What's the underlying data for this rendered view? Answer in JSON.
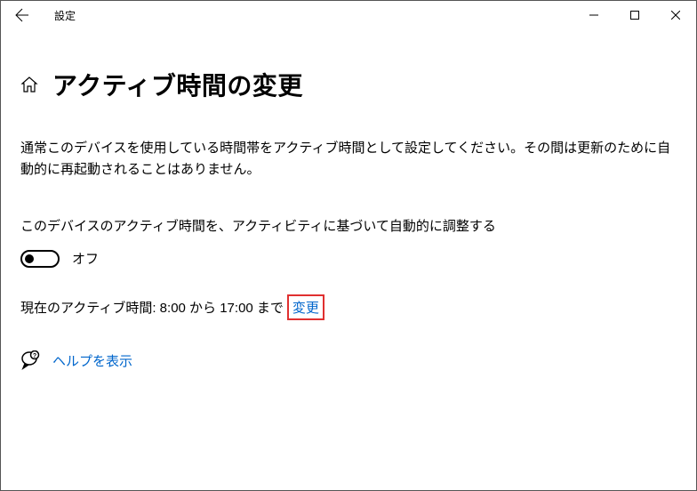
{
  "titlebar": {
    "title": "設定"
  },
  "page": {
    "heading": "アクティブ時間の変更",
    "description": "通常このデバイスを使用している時間帯をアクティブ時間として設定してください。その間は更新のために自動的に再起動されることはありません。",
    "auto_adjust_label": "このデバイスのアクティブ時間を、アクティビティに基づいて自動的に調整する",
    "toggle_state": "オフ",
    "current_hours_prefix": "現在のアクティブ時間: 8:00 から 17:00 まで",
    "change_label": "変更",
    "help_label": "ヘルプを表示"
  }
}
